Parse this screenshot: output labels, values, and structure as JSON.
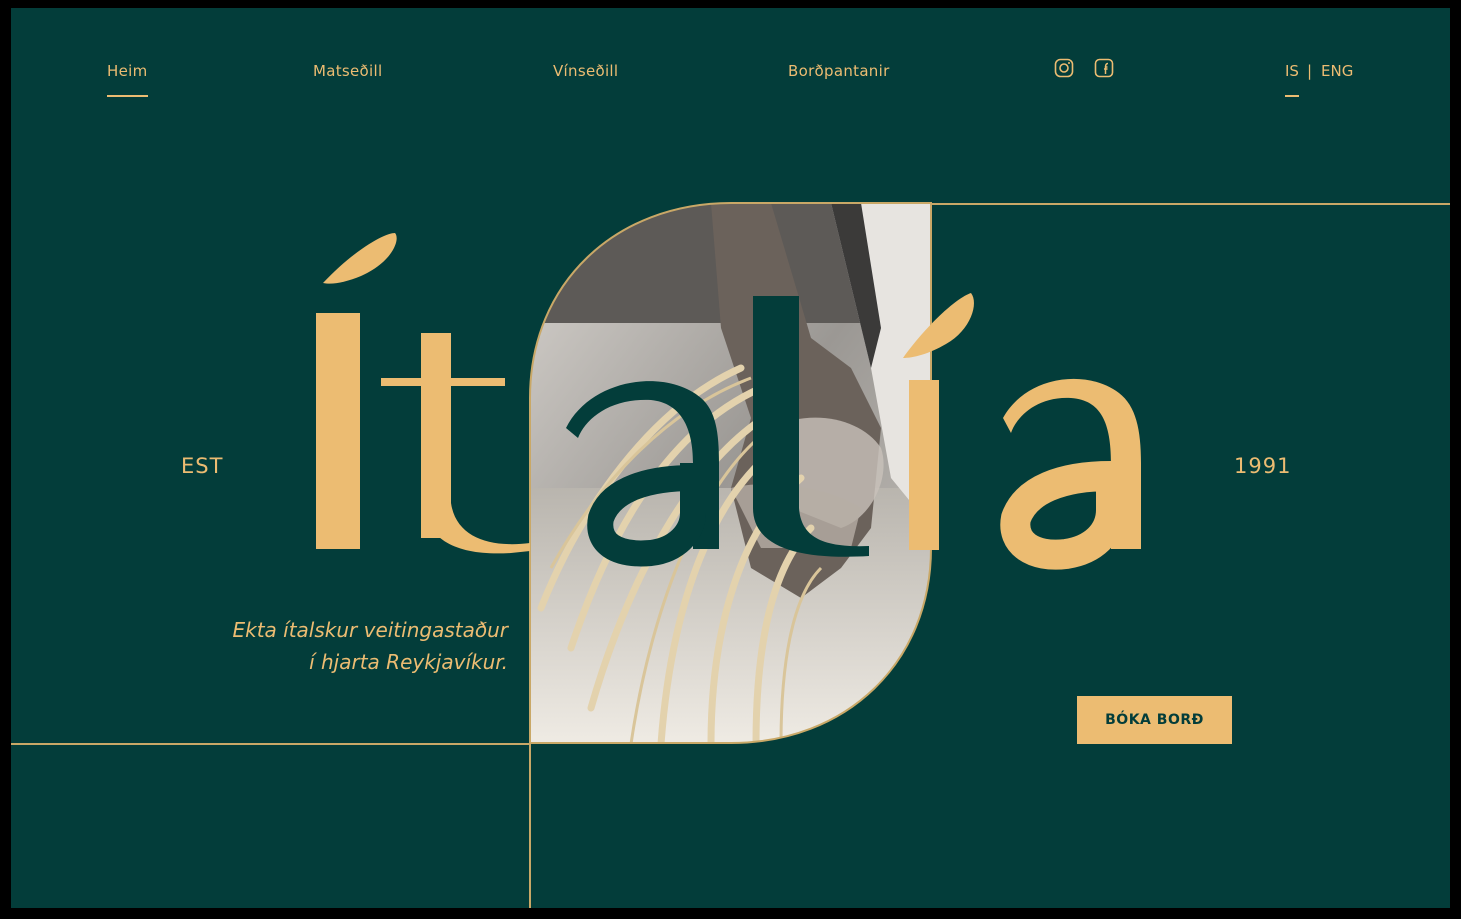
{
  "nav": {
    "items": [
      {
        "label": "Heim",
        "active": true
      },
      {
        "label": "Matseðill",
        "active": false
      },
      {
        "label": "Vínseðill",
        "active": false
      },
      {
        "label": "Borðpantanir",
        "active": false
      }
    ],
    "social": [
      "instagram-icon",
      "facebook-icon"
    ],
    "lang": {
      "is": "IS",
      "sep": "|",
      "eng": "ENG",
      "active": "IS"
    }
  },
  "hero": {
    "wordmark": "ítalía",
    "est_label": "EST",
    "year": "1991",
    "tagline_line1": "Ekta ítalskur veitingastaður",
    "tagline_line2": "í hjarta Reykjavíkur.",
    "cta_label": "BÓKA BORÐ"
  },
  "colors": {
    "background": "#033d3a",
    "accent": "#ecbc72",
    "line": "#c9a867"
  }
}
